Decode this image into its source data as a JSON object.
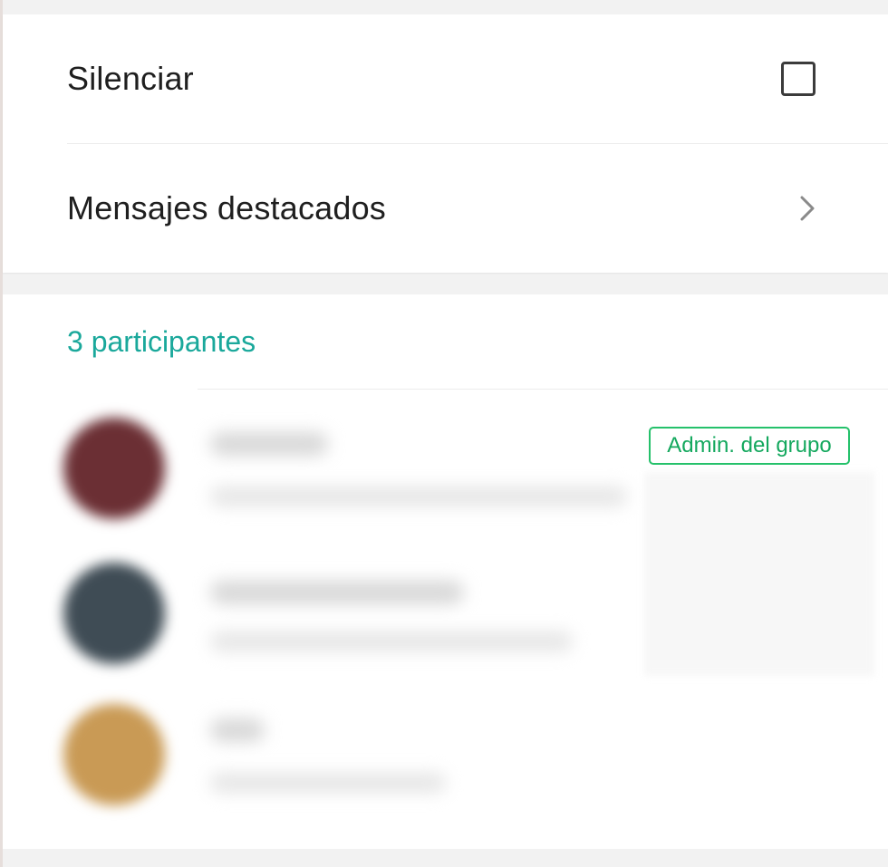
{
  "settings": {
    "mute_label": "Silenciar",
    "mute_checked": false,
    "starred_label": "Mensajes destacados"
  },
  "participants": {
    "count_label": "3 participantes",
    "admin_badge": "Admin. del grupo",
    "items": [
      {
        "avatar_color": "#6b2f34",
        "is_admin": true
      },
      {
        "avatar_color": "#3f4c55",
        "is_admin": false
      },
      {
        "avatar_color": "#c99a55",
        "is_admin": false
      }
    ]
  },
  "colors": {
    "accent": "#1aa89b",
    "admin_green": "#25c16b",
    "text": "#1f1f1f"
  },
  "icons": {
    "checkbox": "checkbox-icon",
    "chevron": "chevron-right-icon"
  }
}
